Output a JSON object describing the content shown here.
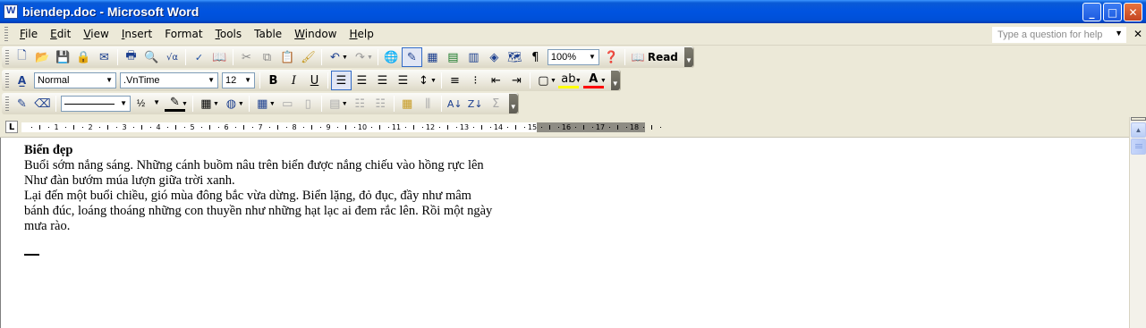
{
  "window": {
    "title": "biendep.doc - Microsoft Word",
    "controls": {
      "minimize": "_",
      "maximize": "□",
      "close": "✕"
    }
  },
  "menubar": {
    "items": [
      {
        "label": "File",
        "key": "F",
        "rest": "ile"
      },
      {
        "label": "Edit",
        "key": "E",
        "rest": "dit"
      },
      {
        "label": "View",
        "key": "V",
        "rest": "iew"
      },
      {
        "label": "Insert",
        "key": "I",
        "rest": "nsert"
      },
      {
        "label": "Format",
        "key": "F",
        "rest": "ormat",
        "key_pos": 1
      },
      {
        "label": "Tools",
        "key": "T",
        "rest": "ools"
      },
      {
        "label": "Table",
        "key": "a",
        "rest": "Table"
      },
      {
        "label": "Window",
        "key": "W",
        "rest": "indow"
      },
      {
        "label": "Help",
        "key": "H",
        "rest": "elp"
      }
    ],
    "help_placeholder": "Type a question for help"
  },
  "standard_toolbar": {
    "zoom": "100%",
    "read_label": "Read"
  },
  "formatting_toolbar": {
    "style": "Normal",
    "font": ".VnTime",
    "size": "12",
    "bold": "B",
    "italic": "I",
    "underline": "U"
  },
  "drawing_toolbar": {
    "line_weight": "½"
  },
  "ruler": {
    "labels": [
      "1",
      "2",
      "3",
      "4",
      "5",
      "6",
      "7",
      "8",
      "9",
      "10",
      "11",
      "12",
      "13",
      "14",
      "15",
      "16",
      "17",
      "18"
    ]
  },
  "document": {
    "heading": "Biển đẹp",
    "lines": [
      "Buổi sớm nắng sáng. Những cánh buồm nâu trên biển được nắng chiếu vào hồng rực lên",
      "Như đàn bướm múa lượn giữa trời xanh.",
      "Lại đến một buổi chiều, gió mùa đông bắc vừa dừng. Biển lặng, đỏ đục, đầy như mâm",
      "bánh đúc, loáng thoáng những con thuyền như những hạt lạc ai đem rắc lên. Rồi một ngày",
      "mưa rào."
    ]
  }
}
